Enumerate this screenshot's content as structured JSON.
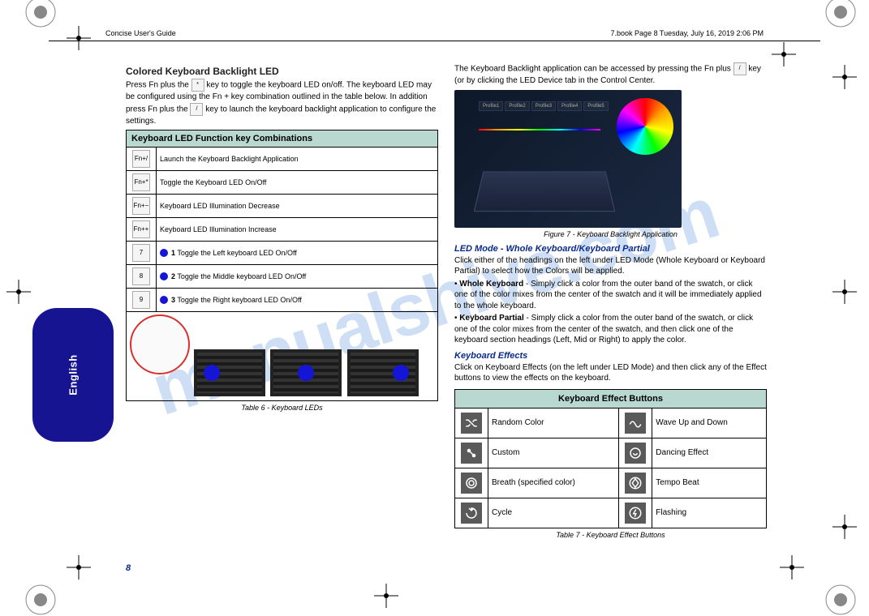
{
  "header": {
    "left": "Concise User's Guide",
    "right": "7.book Page 8 Tuesday, July 16, 2019 2:06 PM"
  },
  "watermark": "manualshive.com",
  "left": {
    "title1": "Colored Keyboard Backlight LED",
    "para1a": "Press Fn plus the ",
    "para1b": " key to toggle the keyboard LED on/off. The keyboard LED may be configured using the Fn + key combination outlined in the table below. In addition press Fn plus the ",
    "para1c": " key to launch the keyboard backlight application to configure the settings.",
    "table_header": "Keyboard LED Function key Combinations",
    "rows": [
      {
        "desc": "Launch the Keyboard Backlight Application"
      },
      {
        "desc": "Toggle the Keyboard LED On/Off"
      },
      {
        "desc": "Keyboard LED Illumination Decrease"
      },
      {
        "desc": "Keyboard LED Illumination Increase"
      },
      {
        "dot": true,
        "label": "1",
        "desc": "Toggle the Left keyboard LED On/Off"
      },
      {
        "dot": true,
        "label": "2",
        "desc": "Toggle the Middle keyboard LED On/Off"
      },
      {
        "dot": true,
        "label": "3",
        "desc": "Toggle the Right keyboard LED On/Off"
      }
    ],
    "table6": "Table 6 - Keyboard LEDs"
  },
  "right": {
    "para_app": "The Keyboard Backlight application can be accessed by pressing the Fn plus ",
    "para_app2": " key (or by clicking the LED Device tab in the Control Center.",
    "figure7": "Figure 7 - Keyboard Backlight Application",
    "led_mode_title": "LED Mode - Whole Keyboard/Keyboard Partial",
    "led_mode_para": "Click either of the headings on the left under LED Mode (Whole Keyboard or Keyboard Partial) to select how the Colors will be applied.",
    "bullets": [
      {
        "label": "Whole Keyboard",
        "desc": " - Simply click a color from the outer band of the swatch, or click one of the color mixes from the center of the swatch and it will be immediately applied to the whole keyboard."
      },
      {
        "label": "Keyboard Partial",
        "desc": " - Simply click a color from the outer band of the swatch, or click one of the color mixes from the center of the swatch, and then click one of the keyboard section headings (Left, Mid or Right) to apply the color."
      }
    ],
    "effects_title": "Keyboard Effects",
    "effects_para": "Click on Keyboard Effects (on the left under LED Mode) and then click any of the Effect buttons to view the effects on the keyboard.",
    "table_header": "Keyboard Effect Buttons",
    "modes": [
      [
        "Random Color",
        "Wave Up and Down"
      ],
      [
        "Custom",
        "Dancing Effect"
      ],
      [
        "Breath (specified color)",
        "Tempo Beat"
      ],
      [
        "Cycle",
        "Flashing"
      ]
    ],
    "table7": "Table 7 - Keyboard Effect Buttons"
  },
  "sidebar": "English",
  "pagenum": "8"
}
